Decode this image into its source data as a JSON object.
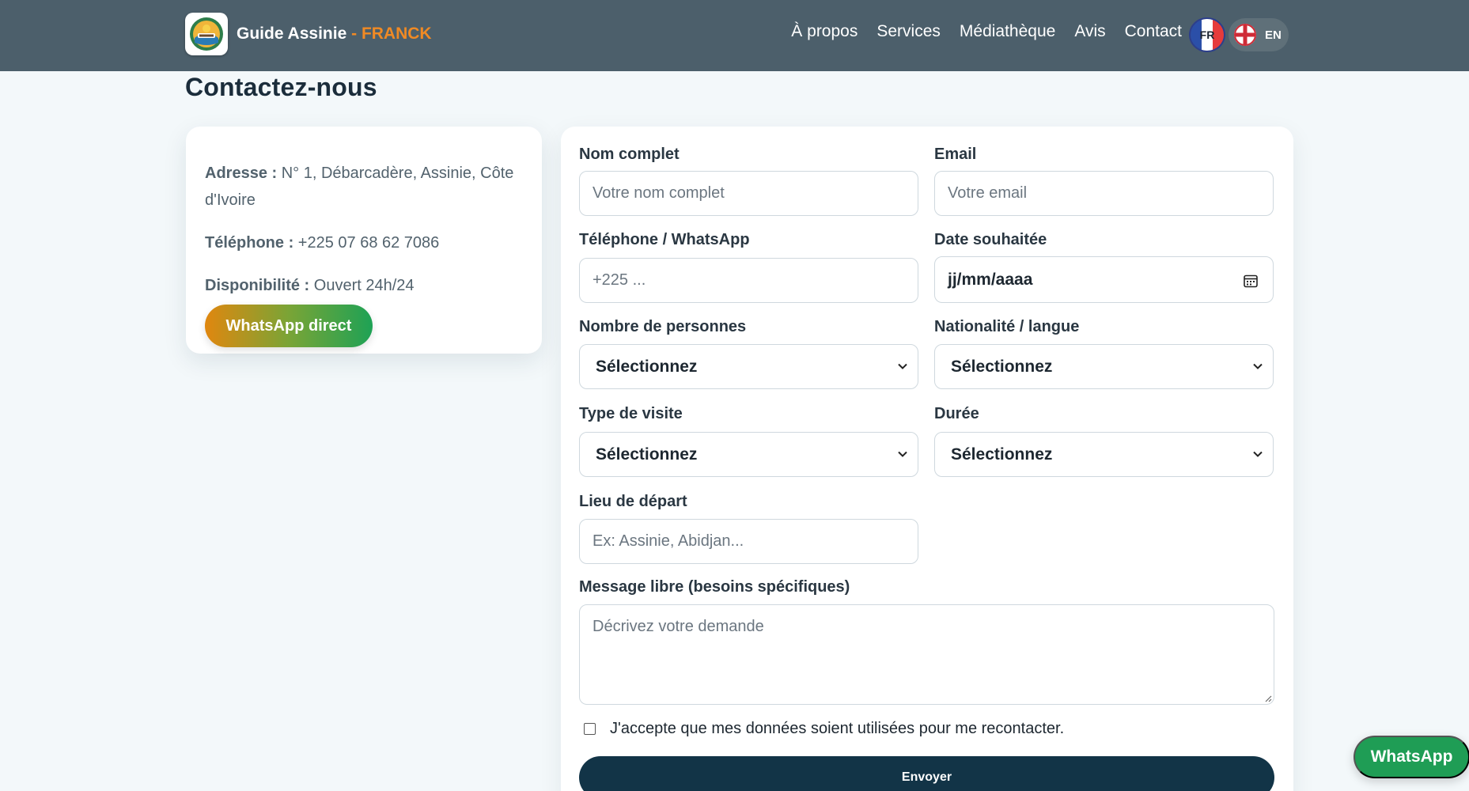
{
  "header": {
    "brand_name": "Guide Assinie",
    "brand_separator": " - ",
    "brand_accent": "FRANCK",
    "nav": [
      {
        "label": "À propos"
      },
      {
        "label": "Services"
      },
      {
        "label": "Médiathèque"
      },
      {
        "label": "Avis"
      },
      {
        "label": "Contact"
      }
    ],
    "lang_fr": "FR",
    "lang_en": "EN"
  },
  "page_title": "Contactez-nous",
  "info": {
    "address_label": "Adresse :",
    "address_value": " N° 1, Débarcadère, Assinie, Côte d'Ivoire",
    "phone_label": "Téléphone :",
    "phone_value": " +225 07 68 62 7086",
    "availability_label": "Disponibilité :",
    "availability_value": " Ouvert 24h/24",
    "whatsapp_button": "WhatsApp direct"
  },
  "form": {
    "name_label": "Nom complet",
    "name_placeholder": "Votre nom complet",
    "email_label": "Email",
    "email_placeholder": "Votre email",
    "phone_label": "Téléphone / WhatsApp",
    "phone_placeholder": "+225 ...",
    "date_label": "Date souhaitée",
    "date_value": "jj/mm/aaaa",
    "people_label": "Nombre de personnes",
    "people_value": "Sélectionnez",
    "nationality_label": "Nationalité / langue",
    "nationality_value": "Sélectionnez",
    "visit_label": "Type de visite",
    "visit_value": "Sélectionnez",
    "duration_label": "Durée",
    "duration_value": "Sélectionnez",
    "departure_label": "Lieu de départ",
    "departure_placeholder": "Ex: Assinie, Abidjan...",
    "message_label": "Message libre (besoins spécifiques)",
    "message_placeholder": "Décrivez votre demande",
    "consent_text": "J'accepte que mes données soient utilisées pour me recontacter.",
    "submit_label": "Envoyer"
  },
  "floating": {
    "whatsapp_label": "WhatsApp"
  },
  "colors": {
    "header_bg": "#4c5f6b",
    "brand_accent": "#f08a24",
    "submit_bg": "#123447",
    "whatsapp_green": "#1f9d55"
  }
}
